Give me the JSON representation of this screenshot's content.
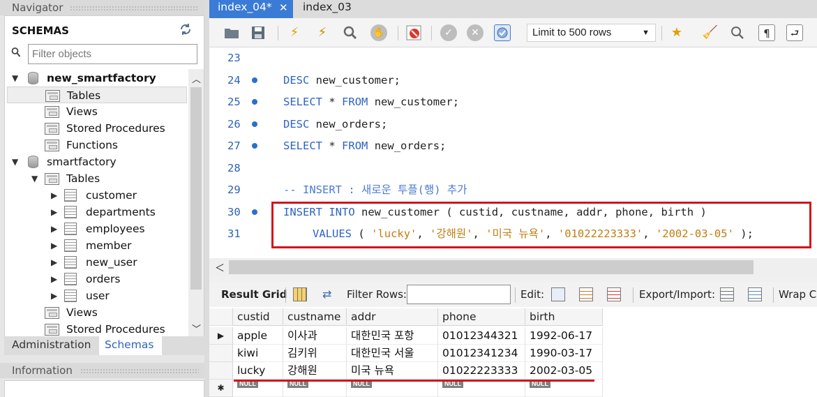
{
  "navigator": {
    "header": "Navigator",
    "schemas_title": "SCHEMAS",
    "filter_placeholder": "Filter objects",
    "tree": [
      {
        "label": "new_smartfactory",
        "bold": true
      },
      {
        "label": "Tables"
      },
      {
        "label": "Views"
      },
      {
        "label": "Stored Procedures"
      },
      {
        "label": "Functions"
      },
      {
        "label": "smartfactory"
      },
      {
        "label": "Tables"
      },
      {
        "label": "customer"
      },
      {
        "label": "departments"
      },
      {
        "label": "employees"
      },
      {
        "label": "member"
      },
      {
        "label": "new_user"
      },
      {
        "label": "orders"
      },
      {
        "label": "user"
      },
      {
        "label": "Views"
      },
      {
        "label": "Stored Procedures"
      }
    ],
    "bottom_tabs": {
      "administration": "Administration",
      "schemas": "Schemas"
    },
    "info_header": "Information"
  },
  "editor_tabs": [
    {
      "label": "index_04*",
      "active": true
    },
    {
      "label": "index_03",
      "active": false
    }
  ],
  "toolbar": {
    "limit_label": "Limit to 500 rows"
  },
  "code_lines": [
    {
      "num": "23",
      "marker": false,
      "text": ""
    },
    {
      "num": "24",
      "marker": true,
      "text": "DESC new_customer;"
    },
    {
      "num": "25",
      "marker": true,
      "text": "SELECT * FROM new_customer;"
    },
    {
      "num": "26",
      "marker": true,
      "text": "DESC new_orders;"
    },
    {
      "num": "27",
      "marker": true,
      "text": "SELECT * FROM new_orders;"
    },
    {
      "num": "28",
      "marker": false,
      "text": ""
    },
    {
      "num": "29",
      "marker": false,
      "text": "-- INSERT : 새로운 투플(행) 추가"
    },
    {
      "num": "30",
      "marker": true,
      "text": "INSERT INTO new_customer ( custid, custname, addr, phone, birth )"
    },
    {
      "num": "31",
      "marker": false,
      "text": "VALUES ( 'lucky', '강해원', '미국 뉴욕', '01022223333', '2002-03-05' );"
    }
  ],
  "result_toolbar": {
    "result_grid": "Result Grid",
    "filter_rows": "Filter Rows:",
    "edit": "Edit:",
    "export_import": "Export/Import:",
    "wrap": "Wrap C"
  },
  "grid": {
    "columns": [
      "custid",
      "custname",
      "addr",
      "phone",
      "birth"
    ],
    "rows": [
      [
        "apple",
        "이사과",
        "대한민국 포항",
        "01012344321",
        "1992-06-17"
      ],
      [
        "kiwi",
        "김키위",
        "대한민국 서울",
        "01012341234",
        "1990-03-17"
      ],
      [
        "lucky",
        "강해원",
        "미국 뉴욕",
        "01022223333",
        "2002-03-05"
      ]
    ],
    "null_label": "NULL",
    "current_row_marker": "▶",
    "new_row_marker": "✱"
  }
}
